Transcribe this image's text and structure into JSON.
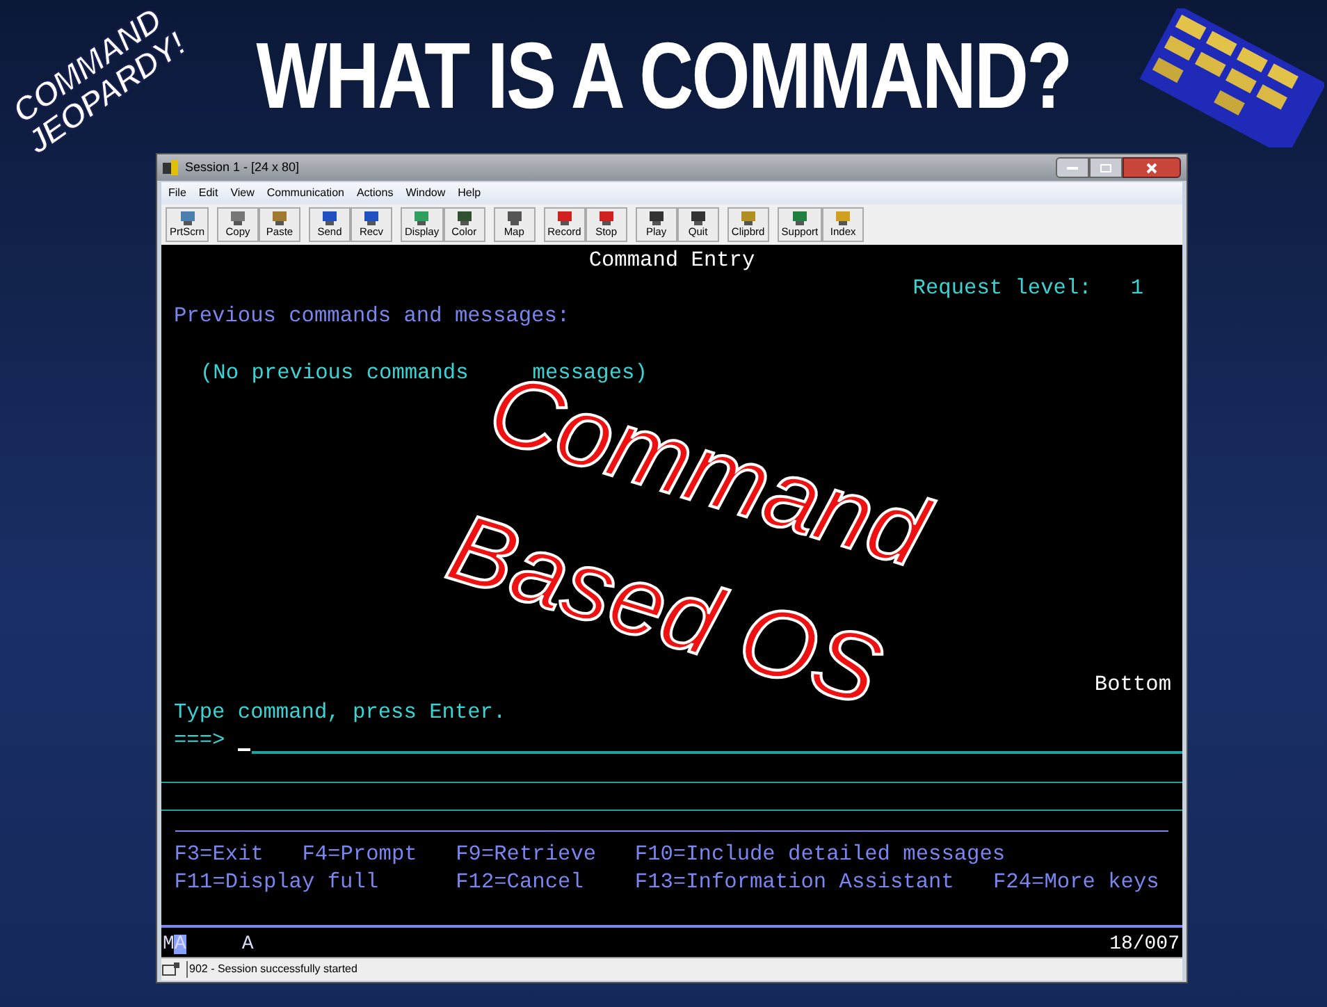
{
  "slide": {
    "logo": [
      "COMMAND",
      "JEOPARDY!"
    ],
    "title": "WHAT IS A COMMAND?",
    "overlay": [
      "Command",
      "Based OS"
    ]
  },
  "window": {
    "title": "Session 1 - [24 x 80]",
    "menu": [
      "File",
      "Edit",
      "View",
      "Communication",
      "Actions",
      "Window",
      "Help"
    ],
    "toolbar": [
      {
        "label": "PrtScrn"
      },
      {
        "label": "Copy"
      },
      {
        "label": "Paste"
      },
      {
        "label": "Send"
      },
      {
        "label": "Recv"
      },
      {
        "label": "Display"
      },
      {
        "label": "Color"
      },
      {
        "label": "Map"
      },
      {
        "label": "Record"
      },
      {
        "label": "Stop"
      },
      {
        "label": "Play"
      },
      {
        "label": "Quit"
      },
      {
        "label": "Clipbrd"
      },
      {
        "label": "Support"
      },
      {
        "label": "Index"
      }
    ]
  },
  "terminal": {
    "screen_title": "Command Entry",
    "request_label": "Request level:",
    "request_value": "1",
    "history_heading": "Previous commands and messages:",
    "history_empty": [
      "(No previous commands",
      "messages)"
    ],
    "position": "Bottom",
    "prompt_text": "Type command, press Enter.",
    "prompt_arrow": "===>",
    "function_keys": [
      [
        "F3=Exit",
        "F4=Prompt",
        "F9=Retrieve",
        "F10=Include detailed messages"
      ],
      [
        "F11=Display full",
        "F12=Cancel",
        "F13=Information Assistant",
        "F24=More keys"
      ]
    ],
    "oia": {
      "mode": "MA",
      "input": "A",
      "cursor_position": "18/007"
    }
  },
  "status_bar": {
    "message": "902 - Session successfully started"
  }
}
